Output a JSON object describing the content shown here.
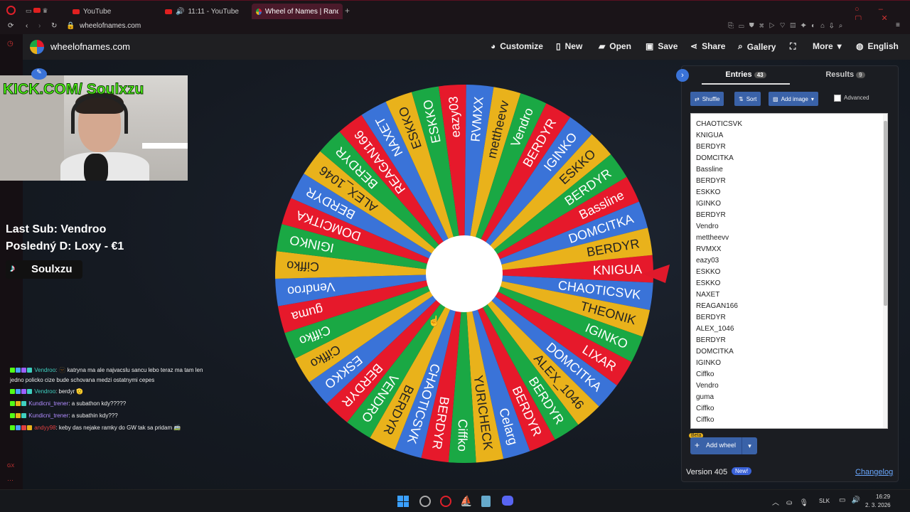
{
  "browser": {
    "tabs": [
      {
        "label": "YouTube"
      },
      {
        "label": "11:11 - YouTube"
      },
      {
        "label": "Wheel of Names | Randon"
      }
    ],
    "url": "wheelofnames.com"
  },
  "site": {
    "title": "wheelofnames.com",
    "nav": [
      "Customize",
      "New",
      "Open",
      "Save",
      "Share",
      "Gallery",
      "More",
      "English"
    ]
  },
  "overlay": {
    "kick": "KICK.COM/ Soulxzu",
    "last_sub": "Last Sub: Vendroo",
    "last_donation": "Posledný D: Loxy - €1",
    "tiktok": "Soulxzu",
    "chat": [
      {
        "user": "Vendroo",
        "user_color": "#3fd0c0",
        "text": ": 🫥 katryna ma ale najvacslu sancu lebo teraz ma tam len"
      },
      {
        "user": "",
        "user_color": "#3fd0c0",
        "text": "jedno policko cize bude schovana medzi ostatnymi cepes"
      },
      {
        "user": "Vendroo",
        "user_color": "#3fd0c0",
        "text": ": berdyr 🫡"
      },
      {
        "user": "Kundicni_trener",
        "user_color": "#b08cff",
        "text": ": a subathon kdy?????"
      },
      {
        "user": "Kundicni_trener",
        "user_color": "#b08cff",
        "text": ": a subathin kdy???"
      },
      {
        "user": "andyy98",
        "user_color": "#e04040",
        "text": ": keby das nejake ramky do GW tak sa pridam 🚎"
      }
    ]
  },
  "wheel": {
    "segments": [
      "KNIGUA",
      "CHAOTICSVK",
      "THEONIK",
      "IGINKO",
      "LIXAR",
      "DOMCITKA",
      "ALEX_1046",
      "BERDYR",
      "BERDYR",
      "Celarg",
      "YURICHECK",
      "Ciffko",
      "BERDYR",
      "CHAOTICSVK",
      "BERDYR",
      "VENDRO",
      "BERDYR",
      "ESKKO",
      "Ciffko",
      "Ciffko",
      "guma",
      "Vendroo",
      "Ciffko",
      "IGINKO",
      "DOMCITKA",
      "BERDYR",
      "ALEX_1046",
      "BERDYR",
      "REAGAN166",
      "NAXET",
      "ESKKO",
      "ESKKO",
      "eazy03",
      "RVMXX",
      "mettheevv",
      "Vendro",
      "BERDYR",
      "IGINKO",
      "ESKKO",
      "BERDYR",
      "Bassline",
      "DOMCITKA",
      "BERDYR"
    ],
    "colors": [
      "#e6192b",
      "#3a73d8",
      "#e9b21b",
      "#1aa844"
    ],
    "pointer_color": "#e0192b"
  },
  "panel": {
    "tab_entries": "Entries",
    "entries_count": "43",
    "tab_results": "Results",
    "results_count": "9",
    "shuffle": "Shuffle",
    "sort": "Sort",
    "add_image": "Add image",
    "advanced": "Advanced",
    "entries": [
      "CHAOTICSVK",
      "KNIGUA",
      "BERDYR",
      "DOMCITKA",
      "Bassline",
      "BERDYR",
      "ESKKO",
      "IGINKO",
      "BERDYR",
      "Vendro",
      "mettheevv",
      "RVMXX",
      "eazy03",
      "ESKKO",
      "ESKKO",
      "NAXET",
      "REAGAN166",
      "BERDYR",
      "ALEX_1046",
      "BERDYR",
      "DOMCITKA",
      "IGINKO",
      "Ciffko",
      "Vendro",
      "guma",
      "Ciffko",
      "Ciffko"
    ],
    "beta": "Beta",
    "add_wheel": "Add wheel",
    "version": "Version 405",
    "new_badge": "New!",
    "changelog": "Changelog"
  },
  "taskbar": {
    "lang": "SLK",
    "time": "16:29",
    "date": "2. 3. 2026"
  }
}
